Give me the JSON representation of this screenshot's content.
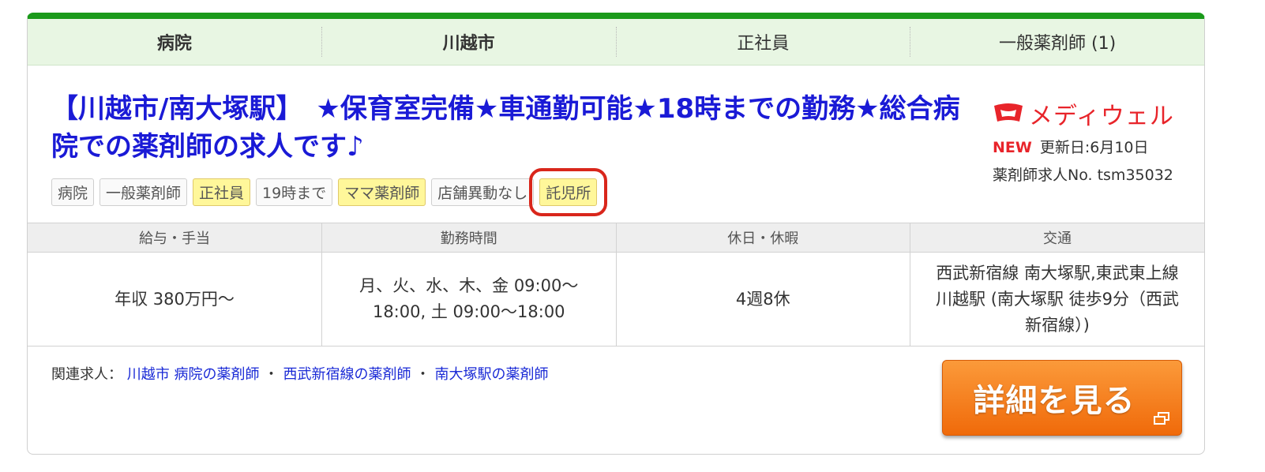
{
  "categories": [
    "病院",
    "川越市",
    "正社員",
    "一般薬剤師 (1)"
  ],
  "job": {
    "title": "【川越市/南大塚駅】　★保育室完備★車通勤可能★18時までの勤務★総合病院での薬剤師の求人です♪",
    "tags": [
      {
        "label": "病院",
        "highlight": false
      },
      {
        "label": "一般薬剤師",
        "highlight": false
      },
      {
        "label": "正社員",
        "highlight": true
      },
      {
        "label": "19時まで",
        "highlight": false
      },
      {
        "label": "ママ薬剤師",
        "highlight": true
      },
      {
        "label": "店舗異動なし",
        "highlight": false
      },
      {
        "label": "託児所",
        "highlight": true,
        "marked": true
      }
    ]
  },
  "brand": {
    "name": "メディウェル",
    "new_label": "NEW",
    "updated": "更新日:6月10日",
    "job_number": "薬剤師求人No. tsm35032",
    "color": "#e8242a"
  },
  "specs": {
    "headers": [
      "給与・手当",
      "勤務時間",
      "休日・休暇",
      "交通"
    ],
    "values": [
      "年収 380万円〜",
      "月、火、水、木、金 09:00〜18:00, 土 09:00〜18:00",
      "4週8休",
      "西武新宿線 南大塚駅,東武東上線 川越駅 (南大塚駅 徒歩9分（西武新宿線）)"
    ]
  },
  "related": {
    "label": "関連求人：",
    "links": [
      "川越市 病院の薬剤師",
      "西武新宿線の薬剤師",
      "南大塚駅の薬剤師"
    ],
    "separator": "・"
  },
  "detail_button": {
    "label": "詳細を見る",
    "icon": "external-window-icon",
    "color": "#f27a14"
  },
  "colors": {
    "accent_green": "#1a9a1a",
    "title_blue": "#1a1ad6",
    "mark_red": "#d9261b"
  }
}
